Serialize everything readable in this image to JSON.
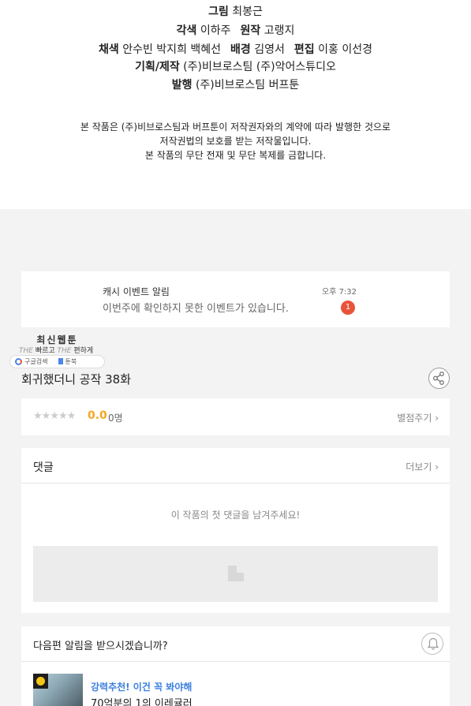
{
  "credits": {
    "lines": [
      [
        {
          "role": "그림",
          "names": "최봉근"
        }
      ],
      [
        {
          "role": "각색",
          "names": "이하주"
        },
        {
          "role": "원작",
          "names": "고랭지"
        }
      ],
      [
        {
          "role": "채색",
          "names": "안수빈  박지희  백혜선"
        },
        {
          "role": "배경",
          "names": "김영서"
        },
        {
          "role": "편집",
          "names": "이홍 이선경"
        }
      ],
      [
        {
          "role": "기획/제작",
          "names": "(주)비브로스팀   (주)악어스튜디오"
        }
      ],
      [
        {
          "role": "발행",
          "names": "(주)비브로스팀   버프툰"
        }
      ]
    ],
    "copyright": [
      "본 작품은 (주)비브로스팀과 버프툰이 저작권자와의 계약에 따라 발행한 것으로",
      "저작권법의 보호를 받는 저작물입니다.",
      "본 작품의 무단 전재 및 무단 복제를 금합니다."
    ]
  },
  "notification": {
    "title": "캐시 이벤트 알림",
    "message": "이번주에 확인하지 못한 이벤트가 있습니다.",
    "time": "오후 7:32",
    "badge": "1"
  },
  "brand": {
    "name": "최신웹툰",
    "tag_the1": "THE",
    "tag_fast": " 빠르고 ",
    "tag_the2": "THE",
    "tag_easy": " 편하게",
    "pill_search": "구글검색",
    "pill_site": "툰북"
  },
  "episode": {
    "title": "회귀했더니 공작 38화"
  },
  "rating": {
    "stars_total": 5,
    "stars_filled": 0,
    "score": "0.0",
    "count": "0명",
    "rate_link": "별점주기 ›"
  },
  "comments": {
    "title": "댓글",
    "more": "더보기 ›",
    "empty": "이 작품의 첫 댓글을 남겨주세요!"
  },
  "next_alert": {
    "question": "다음편 알림을 받으시겠습니까?"
  },
  "promo": {
    "label": "강력추천! 이건 꼭 봐야해",
    "title": "70억분의 1의 이레귤러"
  },
  "colors": {
    "accent_score": "#f5a623",
    "badge_red": "#e8543a",
    "promo_blue": "#3b7fe0"
  },
  "icons": {
    "share": "share-icon",
    "bell": "bell-icon",
    "clock": "clock-icon",
    "google": "google-icon",
    "book": "book-icon"
  }
}
